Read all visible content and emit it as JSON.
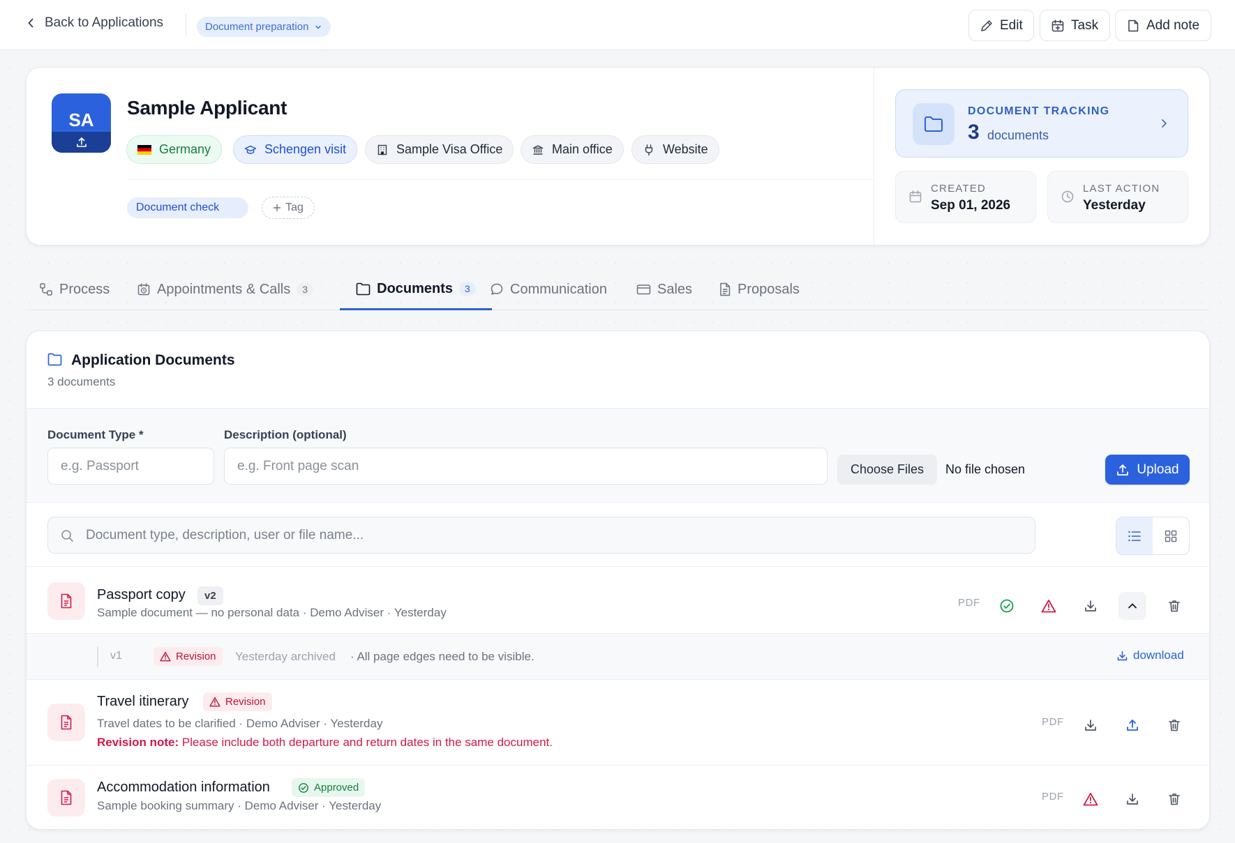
{
  "topbar": {
    "back_label": "Back to Applications",
    "status": "Document preparation",
    "buttons": {
      "edit": "Edit",
      "task": "Task",
      "add_note": "Add note"
    }
  },
  "applicant": {
    "initials": "SA",
    "name": "Sample Applicant",
    "chips": {
      "country": "Germany",
      "visa_type": "Schengen visit",
      "visa_office": "Sample Visa Office",
      "branch": "Main office",
      "source": "Website"
    },
    "tag": "Document check",
    "add_tag_label": "Tag"
  },
  "tracking": {
    "title": "DOCUMENT TRACKING",
    "count": "3",
    "unit": "documents"
  },
  "meta": {
    "created_label": "CREATED",
    "created_value": "Sep 01, 2026",
    "last_action_label": "LAST ACTION",
    "last_action_value": "Yesterday"
  },
  "tabs": {
    "process": "Process",
    "appointments": "Appointments & Calls",
    "appointments_count": "3",
    "documents": "Documents",
    "documents_count": "3",
    "communication": "Communication",
    "sales": "Sales",
    "proposals": "Proposals"
  },
  "documents_panel": {
    "title": "Application Documents",
    "subtitle": "3 documents",
    "form": {
      "type_label": "Document Type *",
      "type_placeholder": "e.g. Passport",
      "desc_label": "Description (optional)",
      "desc_placeholder": "e.g. Front page scan",
      "choose_files": "Choose Files",
      "no_file": "No file chosen",
      "upload": "Upload"
    },
    "search_placeholder": "Document type, description, user or file name...",
    "items": [
      {
        "name": "Passport copy",
        "version": "v2",
        "meta": "Sample document — no personal data · Demo Adviser · Yesterday",
        "file_type": "PDF",
        "history": {
          "version": "v1",
          "status": "Revision",
          "archived": "Yesterday archived",
          "note": "· All page edges need to be visible.",
          "download": "download"
        }
      },
      {
        "name": "Travel itinerary",
        "status": "Revision",
        "meta": "Travel dates to be clarified · Demo Adviser · Yesterday",
        "revision_note_label": "Revision note:",
        "revision_note": "Please include both departure and return dates in the same document.",
        "file_type": "PDF"
      },
      {
        "name": "Accommodation information",
        "status": "Approved",
        "meta": "Sample booking summary · Demo Adviser · Yesterday",
        "file_type": "PDF"
      }
    ]
  },
  "colors": {
    "accent": "#2b61dd",
    "danger": "#d11a4a",
    "success": "#16a34a"
  }
}
